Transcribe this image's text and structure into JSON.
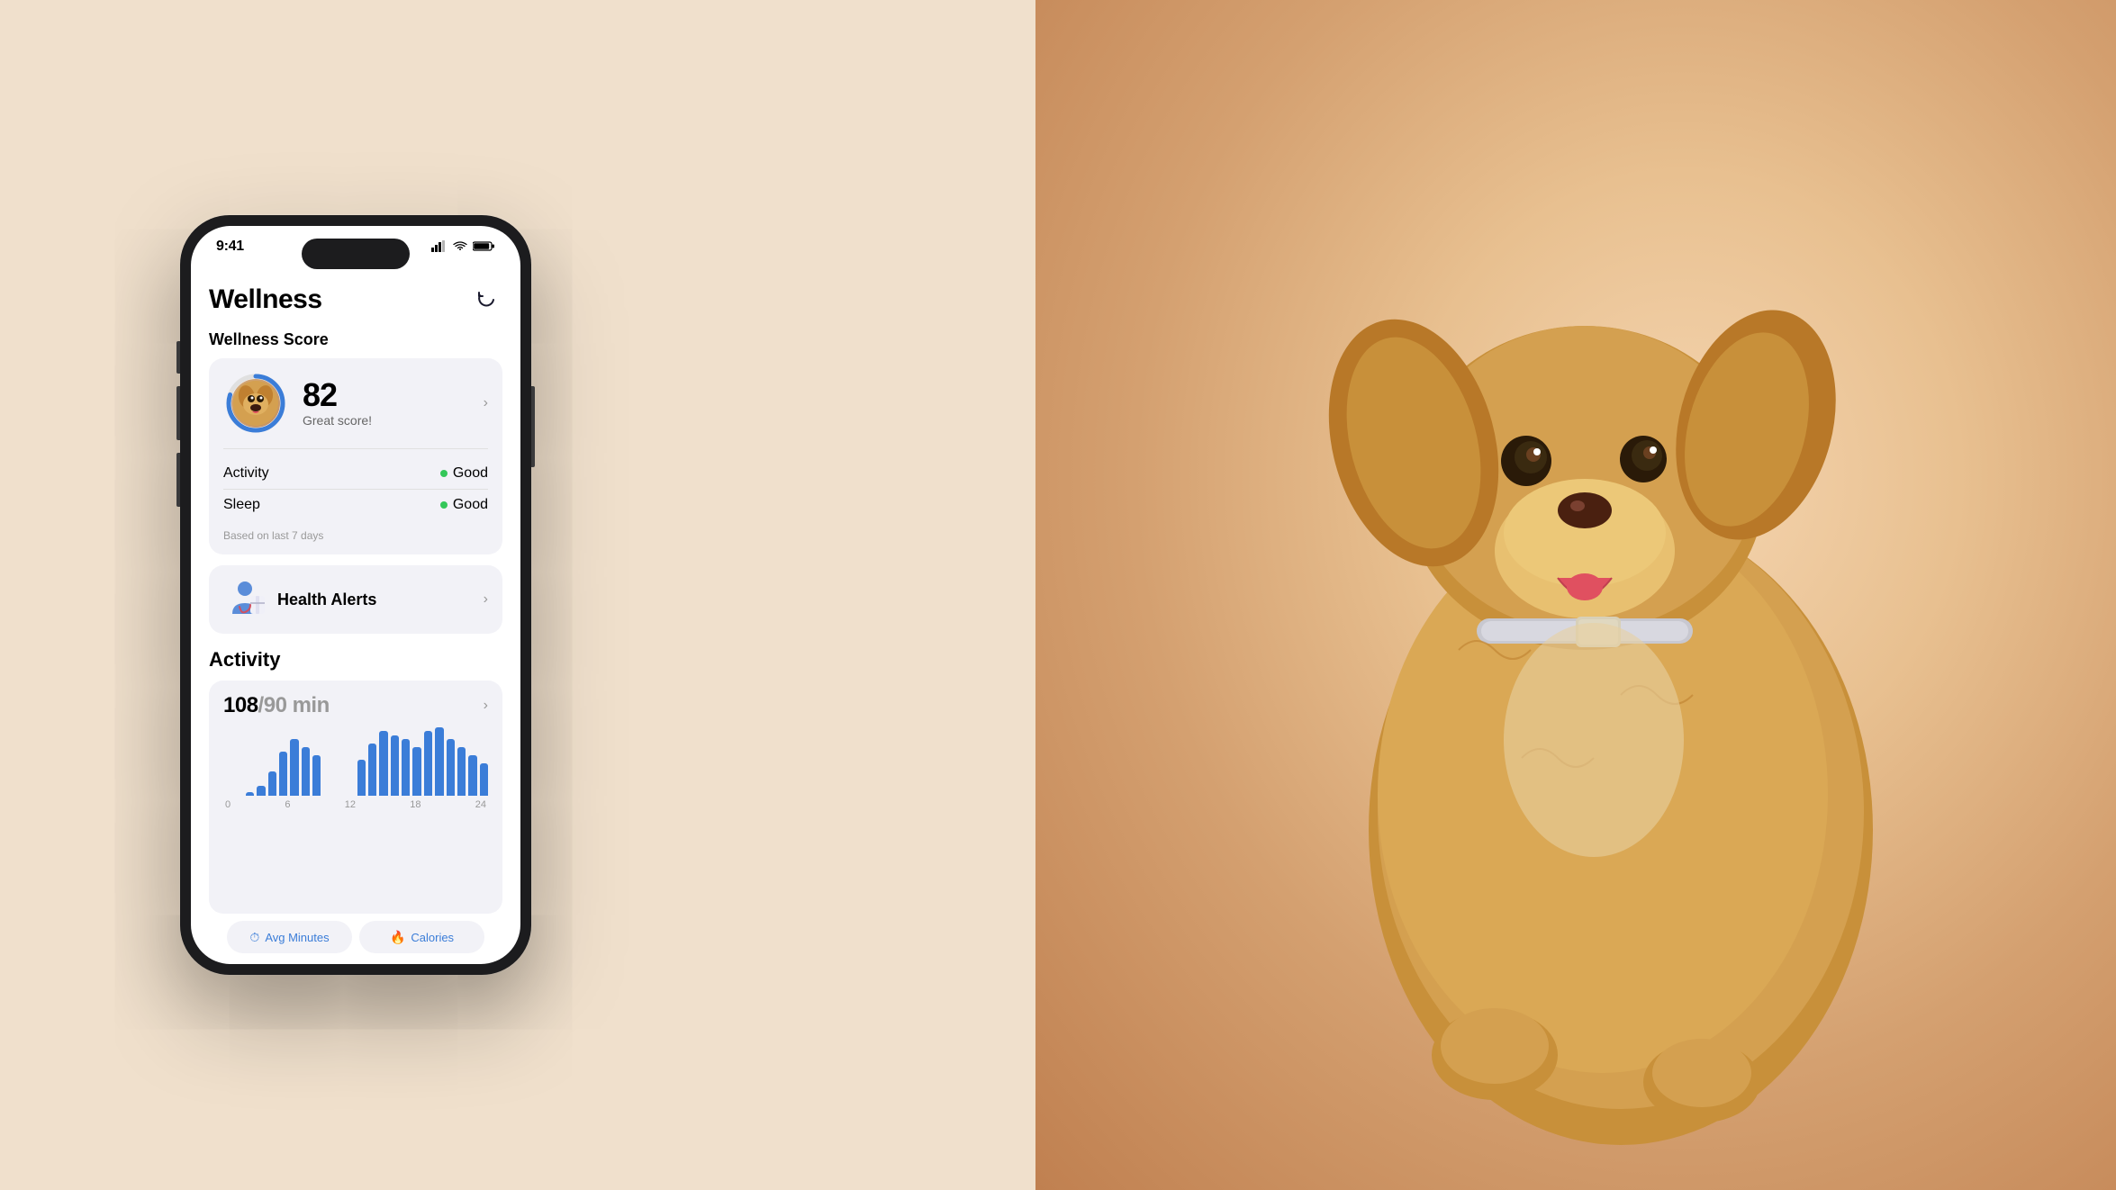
{
  "background": {
    "color": "#f0e0cc"
  },
  "status_bar": {
    "time": "9:41",
    "signal": "▲▲▲",
    "wifi": "WiFi",
    "battery": "Battery"
  },
  "header": {
    "title": "Wellness",
    "refresh_label": "refresh"
  },
  "wellness_score_section": {
    "title": "Wellness Score",
    "score": "82",
    "score_label": "Great score!",
    "score_percent": 82,
    "metrics": [
      {
        "name": "Activity",
        "status": "Good",
        "dot_color": "#34c759"
      },
      {
        "name": "Sleep",
        "status": "Good",
        "dot_color": "#34c759"
      }
    ],
    "based_on": "Based on last 7 days"
  },
  "health_alerts": {
    "label": "Health Alerts"
  },
  "activity_section": {
    "title": "Activity",
    "current_minutes": "108",
    "goal_minutes": "/90 min",
    "chart_bars": [
      0,
      0,
      5,
      12,
      30,
      55,
      70,
      60,
      50,
      0,
      0,
      0,
      45,
      65,
      80,
      75,
      70,
      60,
      80,
      85,
      70,
      60,
      50,
      40
    ],
    "chart_labels": [
      "0",
      "6",
      "12",
      "18",
      "24"
    ],
    "tabs": [
      {
        "icon": "⏱",
        "label": "Avg Minutes"
      },
      {
        "icon": "🔥",
        "label": "Calories"
      }
    ]
  }
}
